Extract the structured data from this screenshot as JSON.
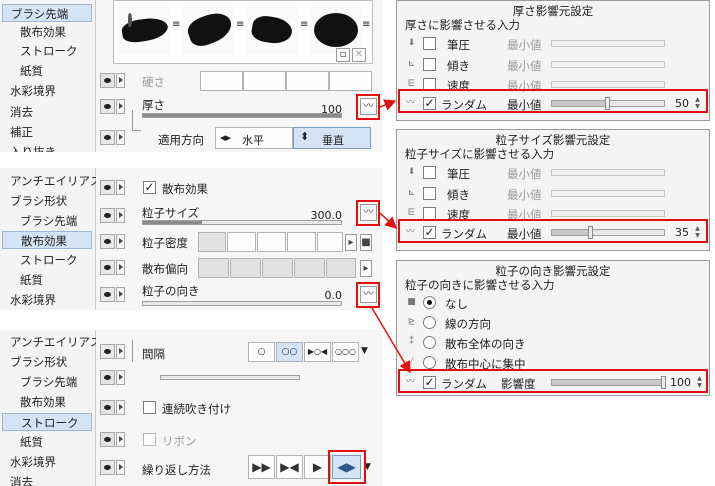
{
  "panel1": {
    "categories": [
      "ブラシ先端",
      "散布効果",
      "ストローク",
      "紙質",
      "水彩境界",
      "消去",
      "補正",
      "入り抜き"
    ],
    "selected_index": 0,
    "hardness_label": "硬さ",
    "thickness_label": "厚さ",
    "thickness_value": "100",
    "thickness_fraction": 1.0,
    "direction_label": "適用方向",
    "direction_options": [
      "水平",
      "垂直"
    ],
    "direction_selected": "垂直"
  },
  "panel2": {
    "categories": [
      "アンチエイリアス",
      "ブラシ形状",
      "ブラシ先端",
      "散布効果",
      "ストローク",
      "紙質",
      "水彩境界"
    ],
    "selected_index": 3,
    "scatter_label": "散布効果",
    "scatter_checked": true,
    "particle_size_label": "粒子サイズ",
    "particle_size_value": "300.0",
    "particle_size_fraction": 0.3,
    "particle_density_label": "粒子密度",
    "scatter_bias_label": "散布偏向",
    "particle_direction_label": "粒子の向き",
    "particle_direction_value": "0.0",
    "particle_direction_fraction": 0.0
  },
  "panel3": {
    "categories": [
      "アンチエイリアス",
      "ブラシ形状",
      "ブラシ先端",
      "散布効果",
      "ストローク",
      "紙質",
      "水彩境界",
      "消去"
    ],
    "selected_index": 4,
    "interval_label": "間隔",
    "continuous_label": "連続吹き付け",
    "continuous_checked": false,
    "ribbon_label": "リボン",
    "ribbon_checked": false,
    "repeat_label": "繰り返し方法"
  },
  "dlg1": {
    "title": "厚さ影響元設定",
    "section": "厚さに影響させる入力",
    "rows": [
      {
        "icon": "pen-pressure-icon",
        "label": "筆圧",
        "min": "最小値",
        "checked": false
      },
      {
        "icon": "tilt-icon",
        "label": "傾き",
        "min": "最小値",
        "checked": false
      },
      {
        "icon": "speed-icon",
        "label": "速度",
        "min": "最小値",
        "checked": false
      }
    ],
    "random": {
      "label": "ランダム",
      "min": "最小値",
      "value": "50",
      "fraction": 0.5,
      "checked": true
    }
  },
  "dlg2": {
    "title": "粒子サイズ影響元設定",
    "section": "粒子サイズに影響させる入力",
    "rows": [
      {
        "icon": "pen-pressure-icon",
        "label": "筆圧",
        "min": "最小値",
        "checked": false
      },
      {
        "icon": "tilt-icon",
        "label": "傾き",
        "min": "最小値",
        "checked": false
      },
      {
        "icon": "speed-icon",
        "label": "速度",
        "min": "最小値",
        "checked": false
      }
    ],
    "random": {
      "label": "ランダム",
      "min": "最小値",
      "value": "35",
      "fraction": 0.35,
      "checked": true
    }
  },
  "dlg3": {
    "title": "粒子の向き影響元設定",
    "section": "粒子の向きに影響させる入力",
    "options": [
      {
        "icon": "none-icon",
        "label": "なし",
        "selected": true
      },
      {
        "icon": "line-direction-icon",
        "label": "線の方向",
        "selected": false
      },
      {
        "icon": "scatter-direction-icon",
        "label": "散布全体の向き",
        "selected": false
      },
      {
        "icon": "scatter-center-icon",
        "label": "散布中心に集中",
        "selected": false
      }
    ],
    "random": {
      "label": "ランダム",
      "min": "影響度",
      "value": "100",
      "fraction": 1.0,
      "checked": true
    }
  },
  "colors": {
    "highlight": "#e11010",
    "selected_bg": "#d4e4f4"
  }
}
